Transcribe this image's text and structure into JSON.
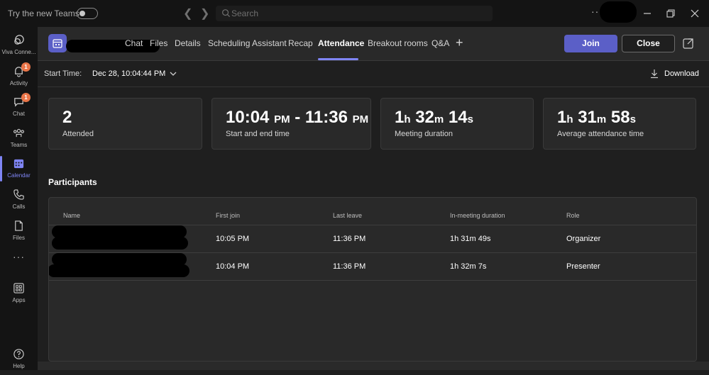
{
  "titlebar": {
    "try_new_teams_label": "Try the new Teams",
    "search_placeholder": "Search",
    "more_glyph": "···"
  },
  "rail": {
    "items": [
      {
        "label": "Viva Conne...",
        "icon": "viva-connections-icon"
      },
      {
        "label": "Activity",
        "icon": "bell-icon",
        "badge": "1"
      },
      {
        "label": "Chat",
        "icon": "chat-icon",
        "badge": "1"
      },
      {
        "label": "Teams",
        "icon": "teams-icon"
      },
      {
        "label": "Calendar",
        "icon": "calendar-icon",
        "active": true
      },
      {
        "label": "Calls",
        "icon": "phone-icon"
      },
      {
        "label": "Files",
        "icon": "file-icon"
      },
      {
        "label": "Apps",
        "icon": "apps-icon"
      },
      {
        "label": "Help",
        "icon": "help-icon"
      }
    ],
    "more_glyph": "···"
  },
  "meeting": {
    "tabs": [
      {
        "label": "Chat"
      },
      {
        "label": "Files"
      },
      {
        "label": "Details"
      },
      {
        "label": "Scheduling Assistant"
      },
      {
        "label": "Recap"
      },
      {
        "label": "Attendance",
        "active": true
      },
      {
        "label": "Breakout rooms"
      },
      {
        "label": "Q&A"
      }
    ],
    "add_tab_glyph": "+",
    "join_label": "Join",
    "close_label": "Close"
  },
  "subheader": {
    "start_time_label": "Start Time:",
    "start_time_value": "Dec 28, 10:04:44 PM",
    "download_label": "Download"
  },
  "stats": {
    "attended": {
      "value": "2",
      "caption": "Attended"
    },
    "start_end": {
      "start": "10:04",
      "start_ampm": "PM",
      "sep": "-",
      "end": "11:36",
      "end_ampm": "PM",
      "caption": "Start and end time"
    },
    "meeting_duration": {
      "h": "1",
      "h_unit": "h",
      "m": "32",
      "m_unit": "m",
      "s": "14",
      "s_unit": "s",
      "caption": "Meeting duration"
    },
    "avg_attendance": {
      "h": "1",
      "h_unit": "h",
      "m": "31",
      "m_unit": "m",
      "s": "58",
      "s_unit": "s",
      "caption": "Average attendance time"
    }
  },
  "participants": {
    "title": "Participants",
    "columns": [
      "Name",
      "First join",
      "Last leave",
      "In-meeting duration",
      "Role"
    ],
    "rows": [
      {
        "first_join": "10:05 PM",
        "last_leave": "11:36 PM",
        "duration": "1h 31m 49s",
        "role": "Organizer"
      },
      {
        "first_join": "10:04 PM",
        "last_leave": "11:36 PM",
        "duration": "1h 32m 7s",
        "role": "Presenter"
      }
    ]
  },
  "colors": {
    "accent": "#5b5fc7",
    "accent_light": "#7f85f5",
    "badge": "#e97548",
    "background": "#1f1f1f",
    "card": "#292929",
    "rail": "#141414"
  }
}
